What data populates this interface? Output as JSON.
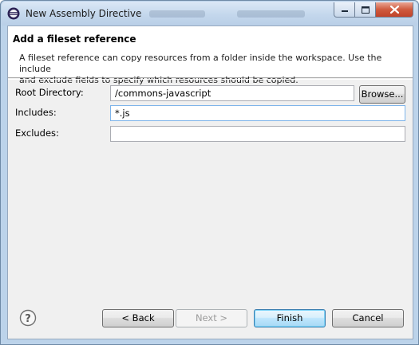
{
  "window": {
    "title": "New Assembly Directive"
  },
  "header": {
    "title": "Add a fileset reference",
    "description_line1": "A fileset reference can copy resources from a folder inside the workspace. Use the include",
    "description_line2": "and exclude fields to specify which resources should be copied."
  },
  "form": {
    "root_directory": {
      "label": "Root Directory:",
      "value": "/commons-javascript"
    },
    "includes": {
      "label": "Includes:",
      "value": "*.js"
    },
    "excludes": {
      "label": "Excludes:",
      "value": ""
    },
    "browse_label": "Browse..."
  },
  "footer": {
    "back_label": "< Back",
    "next_label": "Next >",
    "finish_label": "Finish",
    "cancel_label": "Cancel"
  },
  "icons": {
    "app": "eclipse-icon",
    "help": "help-icon",
    "minimize": "minimize-icon",
    "maximize": "maximize-icon",
    "close": "close-icon"
  },
  "colors": {
    "window_frame": "#bcd3ea",
    "client_background": "#f0f0f0",
    "close_button": "#c1432a",
    "default_button": "#3c7fb1"
  }
}
